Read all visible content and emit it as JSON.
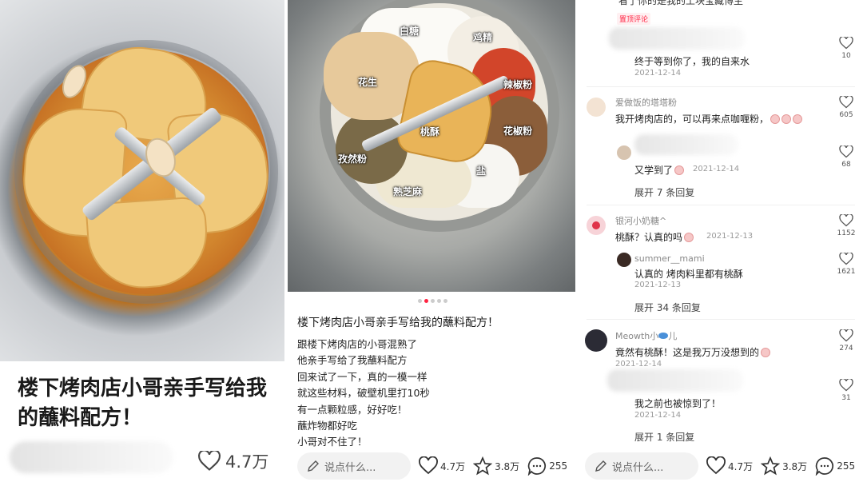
{
  "panel1": {
    "title": "楼下烤肉店小哥亲手写给我的蘸料配方！",
    "likes": "4.7万",
    "colors": {
      "text": "#1a1a1a"
    }
  },
  "panel2": {
    "image_labels": [
      "白糖",
      "鸡精",
      "花生",
      "辣椒粉",
      "桃酥",
      "花椒粉",
      "孜然粉",
      "盐",
      "熟芝麻"
    ],
    "carousel": {
      "total": 5,
      "active": 2
    },
    "title": "楼下烤肉店小哥亲手写给我的蘸料配方！",
    "body_lines": [
      "跟楼下烤肉店的小哥混熟了",
      "他亲手写给了我蘸料配方",
      "回来试了一下，真的一模一样",
      "就这些材料，破壁机里打10秒",
      "有一点颗粒感，好好吃！",
      "蘸炸物都好吃",
      "小哥对不住了！"
    ],
    "bar": {
      "placeholder": "说点什么...",
      "likes": "4.7万",
      "favorites": "3.8万",
      "comments": "255"
    }
  },
  "panel3": {
    "top_cut_text": "看了你的是我的土块宝藏博主",
    "pinned_badge": "置顶评论",
    "comments": [
      {
        "text": "终于等到你了，我的自来水",
        "date": "2021-12-14",
        "likes": "10"
      },
      {
        "user": "爱做饭的塔塔粉",
        "text": "我开烤肉店的，可以再来点咖喱粉，",
        "date": "",
        "likes": "605"
      },
      {
        "text": "又学到了",
        "date": "2021-12-14",
        "likes": "68"
      },
      {
        "user": "银河小奶糖^",
        "text": "桃酥？认真的吗",
        "date": "2021-12-13",
        "likes": "1152"
      },
      {
        "user": "summer__mami",
        "text": "认真的 烤肉料里都有桃酥",
        "date": "2021-12-13",
        "likes": "1621"
      },
      {
        "user": "Meowth小",
        "user_suffix": "儿",
        "text": "竟然有桃酥！这是我万万没想到的",
        "date": "2021-12-14",
        "likes": "274"
      },
      {
        "text": "我之前也被惊到了！",
        "date": "2021-12-14",
        "likes": "31"
      }
    ],
    "expand": [
      "展开 7 条回复",
      "展开 34 条回复",
      "展开 1 条回复"
    ],
    "bar": {
      "placeholder": "说点什么...",
      "likes": "4.7万",
      "favorites": "3.8万",
      "comments": "255"
    }
  },
  "icons": [
    "heart-icon",
    "star-icon",
    "comment-bubble-icon",
    "pencil-icon"
  ],
  "colors": {
    "accent": "#ff2442",
    "muted": "#999999",
    "link": "#444444"
  }
}
